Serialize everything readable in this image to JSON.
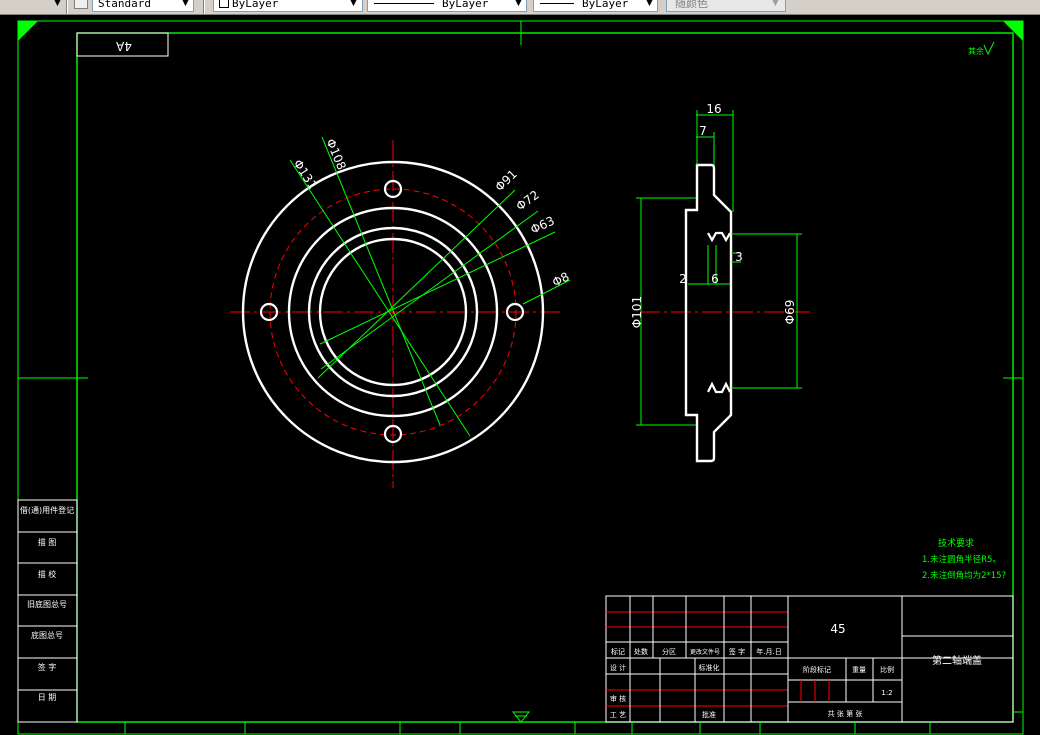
{
  "toolbar": {
    "text_style": "Standard",
    "layer": "ByLayer",
    "linetype": "ByLayer",
    "lineweight": "ByLayer",
    "plot_style": "随颜色"
  },
  "drawing": {
    "corner_label": "4A",
    "roughness_note": "其余",
    "front_view_dims": [
      "Φ131",
      "Φ108",
      "Φ91",
      "Φ72",
      "Φ63",
      "Φ8"
    ],
    "side_view_dims": {
      "width_16": "16",
      "width_7": "7",
      "dim_2": "2",
      "dim_6": "6",
      "dim_3": "3",
      "dia_101": "Φ101",
      "dia_69": "Φ69"
    },
    "tech_req": {
      "title": "技术要求",
      "line1": "1.未注圆角半径R5。",
      "line2": "2.未注倒角均为2*15?"
    },
    "left_block": [
      "借(通)用件登记",
      "描 图",
      "描 校",
      "旧底图总号",
      "底图总号",
      "签 字",
      "日 期"
    ],
    "title_block": {
      "material": "45",
      "part_name": "第二轴端盖",
      "scale": "1:2",
      "row_headers": [
        "标记",
        "处数",
        "分区",
        "更改文件号",
        "签 字",
        "年.月.日"
      ],
      "design": "设 计",
      "standardization": "标准化",
      "stage_mark": "阶段标记",
      "weight": "重量",
      "ratio": "比例",
      "review": "审 核",
      "process": "工 艺",
      "approve": "批准",
      "sheets": "共 张 第 张"
    }
  }
}
